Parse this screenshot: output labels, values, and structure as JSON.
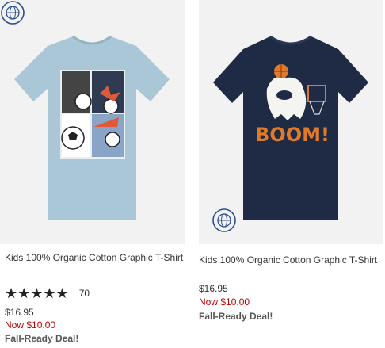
{
  "products": [
    {
      "title": "Kids 100% Organic Cotton Graphic T-Shirt",
      "rating": {
        "stars": "★★★★★",
        "count": "70"
      },
      "price": "$16.95",
      "sale_price": "Now $10.00",
      "promo": "Fall-Ready Deal!",
      "shirt_color": "#a9c7d6",
      "graphic": "soccer-balls"
    },
    {
      "title": "Kids 100% Organic Cotton Graphic T-Shirt",
      "price": "$16.95",
      "sale_price": "Now $10.00",
      "promo": "Fall-Ready Deal!",
      "shirt_color": "#1f2a44",
      "graphic_text": "BOOM!"
    }
  ],
  "colors": {
    "sale": "#c00000",
    "accent_icon": "#2d4f8f"
  }
}
